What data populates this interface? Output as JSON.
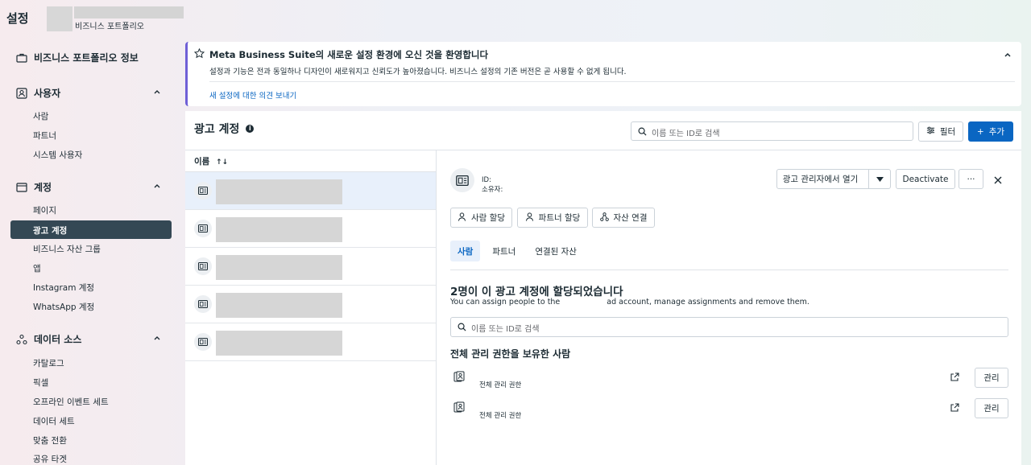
{
  "topbar": {
    "title": "설정",
    "portfolio_label": "비즈니스 포트폴리오"
  },
  "sidebar": {
    "business_info": "비즈니스 포트폴리오 정보",
    "users": {
      "label": "사용자",
      "items": [
        "사람",
        "파트너",
        "시스템 사용자"
      ]
    },
    "accounts": {
      "label": "계정",
      "items": [
        "페이지",
        "광고 계정",
        "비즈니스 자산 그룹",
        "앱",
        "Instagram 계정",
        "WhatsApp 계정"
      ],
      "active": "광고 계정"
    },
    "data_sources": {
      "label": "데이터 소스",
      "items": [
        "카탈로그",
        "픽셀",
        "오프라인 이벤트 세트",
        "데이터 세트",
        "맞춤 전환",
        "공유 타겟"
      ]
    }
  },
  "banner": {
    "title": "Meta Business Suite의 새로운 설정 환경에 오신 것을 환영합니다",
    "description": "설정과 기능은 전과 동일하나 디자인이 새로워지고 신뢰도가 높아졌습니다. 비즈니스 설정의 기존 버전은 곧 사용할 수 없게 됩니다.",
    "link": "새 설정에 대한 의견 보내기"
  },
  "main": {
    "title": "광고 계정",
    "search_placeholder": "이름 또는 ID로 검색",
    "filter_label": "필터",
    "add_label": "추가",
    "list_header": "이름",
    "sort_glyph": "↑↓"
  },
  "detail": {
    "id_label": "ID:",
    "owner_label": "소유자:",
    "open_ads_manager": "광고 관리자에서 열기",
    "deactivate": "Deactivate",
    "more": "···",
    "assign_people": "사람 할당",
    "assign_partner": "파트너 할당",
    "connect_assets": "자산 연결",
    "tabs": [
      "사람",
      "파트너",
      "연결된 자산"
    ],
    "assigned_title": "2명이 이 광고 계정에 할당되었습니다",
    "assigned_sub_before": "You can assign people to the",
    "assigned_sub_after": "ad account, manage assignments and remove them.",
    "people_search_placeholder": "이름 또는 ID로 검색",
    "full_control_title": "전체 관리 권한을 보유한 사람",
    "people": [
      {
        "role": "전체 관리 권한",
        "action": "관리"
      },
      {
        "role": "전체 관리 권한",
        "action": "관리"
      }
    ]
  },
  "colors": {
    "primary": "#0a66c2",
    "active_nav": "#344854",
    "selected_row": "#e8f0fb"
  }
}
